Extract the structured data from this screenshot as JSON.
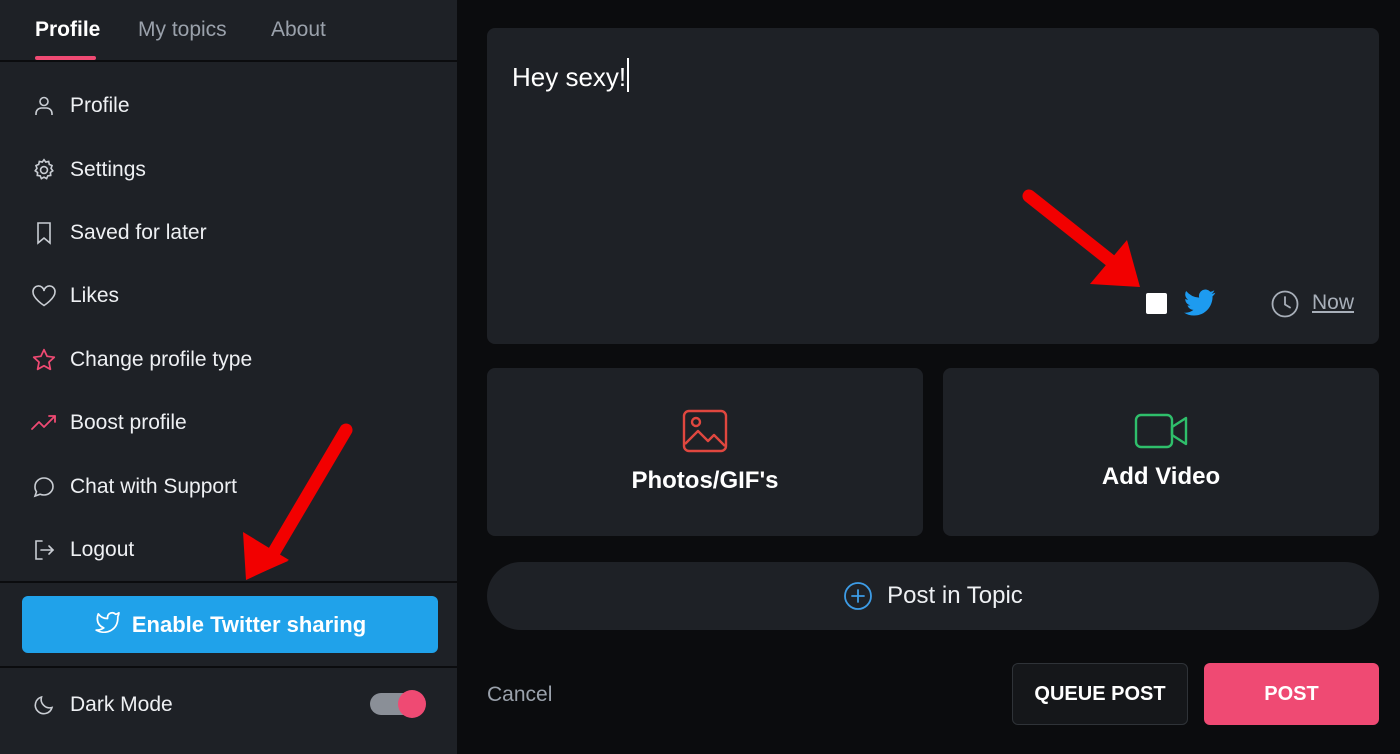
{
  "tabs": [
    {
      "label": "Profile",
      "active": true
    },
    {
      "label": "My topics",
      "active": false
    },
    {
      "label": "About",
      "active": false
    }
  ],
  "menu": [
    {
      "label": "Profile",
      "icon": "user-icon"
    },
    {
      "label": "Settings",
      "icon": "gear-icon"
    },
    {
      "label": "Saved for later",
      "icon": "bookmark-icon"
    },
    {
      "label": "Likes",
      "icon": "heart-icon"
    },
    {
      "label": "Change profile type",
      "icon": "star-icon"
    },
    {
      "label": "Boost profile",
      "icon": "trending-up-icon"
    },
    {
      "label": "Chat with Support",
      "icon": "chat-bubble-icon"
    },
    {
      "label": "Logout",
      "icon": "logout-icon"
    }
  ],
  "twitter": {
    "label": "Enable Twitter sharing",
    "icon": "twitter-icon"
  },
  "dark_mode": {
    "label": "Dark Mode",
    "icon": "moon-icon",
    "enabled": true
  },
  "composer": {
    "text": "Hey sexy!",
    "share_to_twitter_checked": false,
    "schedule_label": "Now"
  },
  "media": {
    "photos_label": "Photos/GIF's",
    "video_label": "Add Video"
  },
  "topic": {
    "label": "Post in Topic",
    "icon": "plus-circle-icon"
  },
  "actions": {
    "cancel_label": "Cancel",
    "queue_label": "QUEUE POST",
    "post_label": "POST"
  },
  "colors": {
    "accent": "#ef4a73",
    "twitter_blue": "#20a2ea",
    "panel_bg": "#1e2126",
    "page_bg": "#0b0c0e",
    "photo_icon": "#e0473f",
    "video_icon": "#2fbf6b",
    "annotation_arrow": "#f20000"
  }
}
